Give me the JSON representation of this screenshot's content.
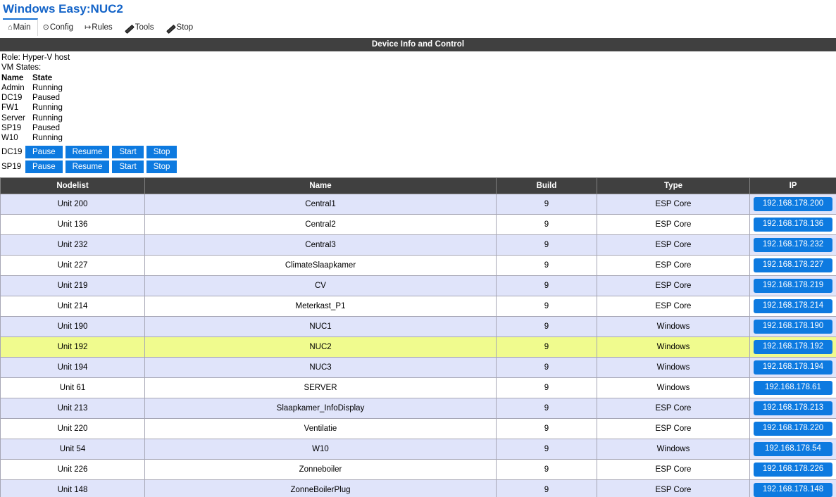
{
  "header": {
    "title": "Windows Easy:NUC2",
    "tabs": [
      {
        "label": "Main",
        "icon": "home-icon",
        "glyph": "⌂",
        "active": true
      },
      {
        "label": "Config",
        "icon": "gear-icon",
        "glyph": "⊙",
        "active": false
      },
      {
        "label": "Rules",
        "icon": "arrow-icon",
        "glyph": "↦",
        "active": false
      },
      {
        "label": "Tools",
        "icon": "wrench-icon",
        "glyph": "",
        "active": false
      },
      {
        "label": "Stop",
        "icon": "wrench-icon",
        "glyph": "",
        "active": false
      }
    ]
  },
  "banner": {
    "title": "Device Info and Control"
  },
  "info": {
    "role_line": "Role: Hyper-V host",
    "vm_states_label": "VM States:",
    "vm_header": {
      "name": "Name",
      "state": "State"
    },
    "vms": [
      {
        "name": "Admin",
        "state": "Running"
      },
      {
        "name": "DC19",
        "state": "Paused"
      },
      {
        "name": "FW1",
        "state": "Running"
      },
      {
        "name": "Server",
        "state": "Running"
      },
      {
        "name": "SP19",
        "state": "Paused"
      },
      {
        "name": "W10",
        "state": "Running"
      }
    ]
  },
  "controls": [
    {
      "vm": "DC19",
      "buttons": [
        {
          "label": "Pause",
          "size": "normal"
        },
        {
          "label": "Resume",
          "size": "wide"
        },
        {
          "label": "Start",
          "size": "narrow"
        },
        {
          "label": "Stop",
          "size": "narrow"
        }
      ]
    },
    {
      "vm": "SP19",
      "buttons": [
        {
          "label": "Pause",
          "size": "normal"
        },
        {
          "label": "Resume",
          "size": "wide"
        },
        {
          "label": "Start",
          "size": "narrow"
        },
        {
          "label": "Stop",
          "size": "narrow"
        }
      ]
    }
  ],
  "node_table": {
    "columns": [
      "Nodelist",
      "Name",
      "Build",
      "Type",
      "IP"
    ],
    "rows": [
      {
        "nodelist": "Unit 200",
        "name": "Central1",
        "build": "9",
        "type": "ESP Core",
        "ip": "192.168.178.200",
        "style": "alt"
      },
      {
        "nodelist": "Unit 136",
        "name": "Central2",
        "build": "9",
        "type": "ESP Core",
        "ip": "192.168.178.136",
        "style": "plain"
      },
      {
        "nodelist": "Unit 232",
        "name": "Central3",
        "build": "9",
        "type": "ESP Core",
        "ip": "192.168.178.232",
        "style": "alt"
      },
      {
        "nodelist": "Unit 227",
        "name": "ClimateSlaapkamer",
        "build": "9",
        "type": "ESP Core",
        "ip": "192.168.178.227",
        "style": "plain"
      },
      {
        "nodelist": "Unit 219",
        "name": "CV",
        "build": "9",
        "type": "ESP Core",
        "ip": "192.168.178.219",
        "style": "alt"
      },
      {
        "nodelist": "Unit 214",
        "name": "Meterkast_P1",
        "build": "9",
        "type": "ESP Core",
        "ip": "192.168.178.214",
        "style": "plain"
      },
      {
        "nodelist": "Unit 190",
        "name": "NUC1",
        "build": "9",
        "type": "Windows",
        "ip": "192.168.178.190",
        "style": "alt"
      },
      {
        "nodelist": "Unit 192",
        "name": "NUC2",
        "build": "9",
        "type": "Windows",
        "ip": "192.168.178.192",
        "style": "hl"
      },
      {
        "nodelist": "Unit 194",
        "name": "NUC3",
        "build": "9",
        "type": "Windows",
        "ip": "192.168.178.194",
        "style": "alt"
      },
      {
        "nodelist": "Unit 61",
        "name": "SERVER",
        "build": "9",
        "type": "Windows",
        "ip": "192.168.178.61",
        "style": "plain"
      },
      {
        "nodelist": "Unit 213",
        "name": "Slaapkamer_InfoDisplay",
        "build": "9",
        "type": "ESP Core",
        "ip": "192.168.178.213",
        "style": "alt"
      },
      {
        "nodelist": "Unit 220",
        "name": "Ventilatie",
        "build": "9",
        "type": "ESP Core",
        "ip": "192.168.178.220",
        "style": "plain"
      },
      {
        "nodelist": "Unit 54",
        "name": "W10",
        "build": "9",
        "type": "Windows",
        "ip": "192.168.178.54",
        "style": "alt"
      },
      {
        "nodelist": "Unit 226",
        "name": "Zonneboiler",
        "build": "9",
        "type": "ESP Core",
        "ip": "192.168.178.226",
        "style": "plain"
      },
      {
        "nodelist": "Unit 148",
        "name": "ZonneBoilerPlug",
        "build": "9",
        "type": "ESP Core",
        "ip": "192.168.178.148",
        "style": "alt"
      }
    ]
  },
  "colors": {
    "accent_blue": "#1464c8",
    "button_blue": "#0d7ae0",
    "banner_dark": "#404040",
    "row_alt": "#e0e4fa",
    "row_highlight": "#f0fb8e"
  }
}
